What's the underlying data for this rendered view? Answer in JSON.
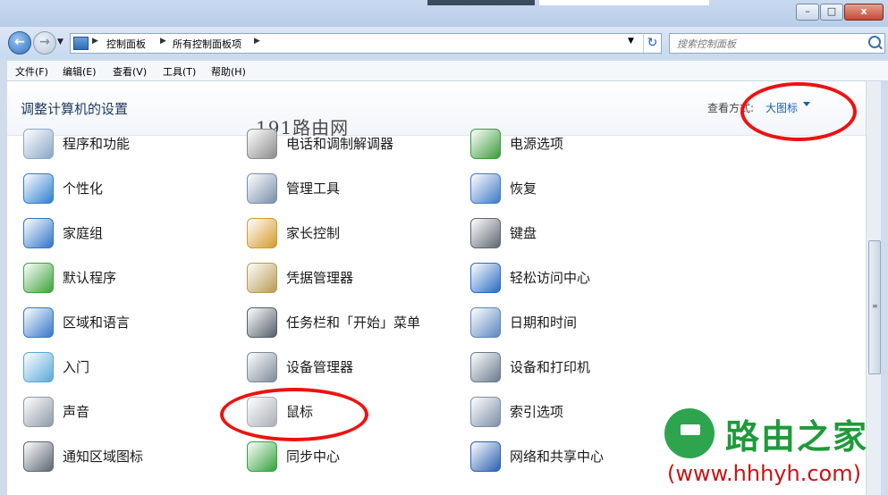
{
  "window": {
    "controls": {
      "minimize": "–",
      "maximize": "□",
      "close": "x"
    }
  },
  "address": {
    "back_arrow": "←",
    "forward_arrow": "→",
    "breadcrumbs": [
      "控制面板",
      "所有控制面板项"
    ],
    "separator": "▶",
    "dropdown": "▼",
    "refresh": "↻",
    "search_placeholder": "搜索控制面板"
  },
  "menubar": [
    "文件(F)",
    "编辑(E)",
    "查看(V)",
    "工具(T)",
    "帮助(H)"
  ],
  "header": {
    "title": "调整计算机的设置",
    "view_by_label": "查看方式:",
    "view_by_value": "大图标"
  },
  "watermark_top": "191路由网",
  "items": [
    {
      "label": "程序和功能",
      "icon": "programs-icon",
      "color": "#8aa6c8"
    },
    {
      "label": "电话和调制解调器",
      "icon": "phone-icon",
      "color": "#8b8b8b"
    },
    {
      "label": "电源选项",
      "icon": "power-icon",
      "color": "#3c9a3c"
    },
    {
      "label": "个性化",
      "icon": "personalize-icon",
      "color": "#2f7fcf"
    },
    {
      "label": "管理工具",
      "icon": "admin-tools-icon",
      "color": "#7a8ea8"
    },
    {
      "label": "恢复",
      "icon": "recovery-icon",
      "color": "#3f79c6"
    },
    {
      "label": "家庭组",
      "icon": "homegroup-icon",
      "color": "#2f75c8"
    },
    {
      "label": "家长控制",
      "icon": "parental-control-icon",
      "color": "#d49a2a"
    },
    {
      "label": "键盘",
      "icon": "keyboard-icon",
      "color": "#5e6670"
    },
    {
      "label": "默认程序",
      "icon": "default-programs-icon",
      "color": "#3aa33a"
    },
    {
      "label": "凭据管理器",
      "icon": "credential-manager-icon",
      "color": "#b89a52"
    },
    {
      "label": "轻松访问中心",
      "icon": "ease-of-access-icon",
      "color": "#2a6bc2"
    },
    {
      "label": "区域和语言",
      "icon": "region-language-icon",
      "color": "#3576c9"
    },
    {
      "label": "任务栏和「开始」菜单",
      "icon": "taskbar-icon",
      "color": "#555e6a"
    },
    {
      "label": "日期和时间",
      "icon": "date-time-icon",
      "color": "#5b86bf"
    },
    {
      "label": "入门",
      "icon": "getting-started-icon",
      "color": "#5aa8d8"
    },
    {
      "label": "设备管理器",
      "icon": "device-manager-icon",
      "color": "#7d8a99"
    },
    {
      "label": "设备和打印机",
      "icon": "devices-printers-icon",
      "color": "#6a7a8c"
    },
    {
      "label": "声音",
      "icon": "sound-icon",
      "color": "#8f9aa6"
    },
    {
      "label": "鼠标",
      "icon": "mouse-icon",
      "color": "#a9afb6"
    },
    {
      "label": "索引选项",
      "icon": "indexing-icon",
      "color": "#7c8fa6"
    },
    {
      "label": "通知区域图标",
      "icon": "notification-area-icon",
      "color": "#5c6672"
    },
    {
      "label": "同步中心",
      "icon": "sync-center-icon",
      "color": "#33a23a"
    },
    {
      "label": "网络和共享中心",
      "icon": "network-sharing-icon",
      "color": "#2a5fb0"
    }
  ],
  "logo": {
    "name": "路由之家",
    "url": "(www.hhhyh.com)"
  }
}
